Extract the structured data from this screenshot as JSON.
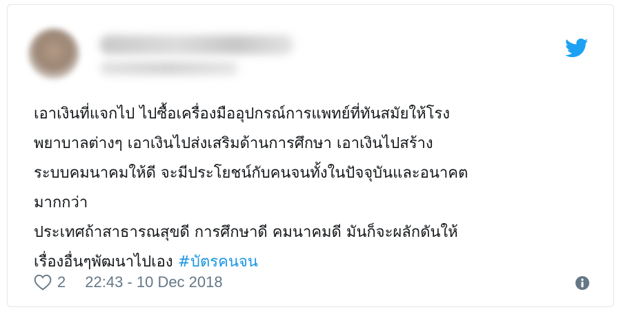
{
  "tweet": {
    "lines": [
      "เอาเงินที่แจกไป ไปซื้อเครื่องมืออุปกรณ์การแพทย์ที่ทันสมัยให้โรง",
      "พยาบาลต่างๆ เอาเงินไปส่งเสริมด้านการศึกษา เอาเงินไปสร้าง",
      "ระบบคมนาคมให้ดี จะมีประโยชน์กับคนจนทั้งในปัจจุบันและอนาคต",
      "มากกว่า",
      "ประเทศถ้าสาธารณสุขดี การศึกษาดี คมนาคมดี มันก็จะผลักดันให้"
    ],
    "last_line_text": "เรื่องอื่นๆพัฒนาไปเอง ",
    "hashtag": "#บัตรคนจน",
    "likes": "2",
    "timestamp": "22:43 - 10 Dec 2018"
  },
  "icons": {
    "brand": "twitter-bird-icon",
    "like": "heart-icon",
    "info": "info-icon"
  },
  "colors": {
    "twitter_blue": "#1da1f2",
    "hashtag": "#1b95e0",
    "text": "#14171a",
    "meta": "#657786",
    "border": "#e1e8ed"
  }
}
